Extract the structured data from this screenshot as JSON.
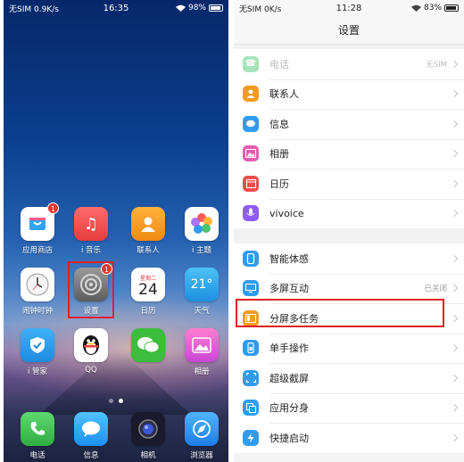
{
  "home": {
    "status": {
      "carrier": "无SIM 0.9K/s",
      "time": "16:35",
      "battery": "98%"
    },
    "apps": [
      {
        "label": "应用商店",
        "icon": "app-store-icon",
        "badge": "1"
      },
      {
        "label": "i 音乐",
        "icon": "music-note-icon"
      },
      {
        "label": "联系人",
        "icon": "contacts-icon"
      },
      {
        "label": "i 主题",
        "icon": "theme-petals-icon"
      },
      {
        "label": "闹钟时钟",
        "icon": "clock-icon"
      },
      {
        "label": "设置",
        "icon": "settings-gear-icon",
        "badge": "1"
      },
      {
        "label": "日历",
        "icon": "calendar-icon",
        "weekday": "星期二",
        "day": "24"
      },
      {
        "label": "天气",
        "icon": "weather-icon",
        "temp": "21°"
      },
      {
        "label": "i 管家",
        "icon": "shield-check-icon"
      },
      {
        "label": "QQ",
        "icon": "qq-penguin-icon"
      },
      {
        "label": "",
        "icon": "wechat-icon"
      },
      {
        "label": "相册",
        "icon": "gallery-icon"
      }
    ],
    "dock": [
      {
        "label": "电话",
        "icon": "phone-icon"
      },
      {
        "label": "信息",
        "icon": "message-bubble-icon"
      },
      {
        "label": "相机",
        "icon": "camera-icon"
      },
      {
        "label": "浏览器",
        "icon": "browser-icon"
      }
    ]
  },
  "settings": {
    "status": {
      "carrier": "无SIM 0K/s",
      "time": "11:28",
      "battery": "83%"
    },
    "title": "设置",
    "group1": [
      {
        "label": "电话",
        "value": "无SIM",
        "icon": "phone-icon",
        "color": "#3fbf6a",
        "dim": true
      },
      {
        "label": "联系人",
        "icon": "contacts-icon",
        "color": "#f39a1c"
      },
      {
        "label": "信息",
        "icon": "message-bubble-icon",
        "color": "#2f9cf0"
      },
      {
        "label": "相册",
        "icon": "gallery-icon",
        "color": "#e65bb0"
      },
      {
        "label": "日历",
        "icon": "calendar-icon",
        "color": "#ef4d4d"
      },
      {
        "label": "vivoice",
        "icon": "microphone-icon",
        "color": "#8e5cf0"
      }
    ],
    "group2": [
      {
        "label": "智能体感",
        "icon": "motion-sense-icon",
        "color": "#2f9cf0"
      },
      {
        "label": "多屏互动",
        "value": "已关闭",
        "icon": "multi-screen-icon",
        "color": "#2f9cf0"
      },
      {
        "label": "分屏多任务",
        "icon": "split-screen-icon",
        "color": "#f39a1c"
      },
      {
        "label": "单手操作",
        "icon": "one-hand-icon",
        "color": "#2f9cf0"
      },
      {
        "label": "超级截屏",
        "icon": "screenshot-icon",
        "color": "#2f9cf0"
      },
      {
        "label": "应用分身",
        "icon": "app-clone-icon",
        "color": "#2f9cf0"
      },
      {
        "label": "快捷启动",
        "icon": "quick-launch-icon",
        "color": "#2f9cf0"
      }
    ]
  }
}
